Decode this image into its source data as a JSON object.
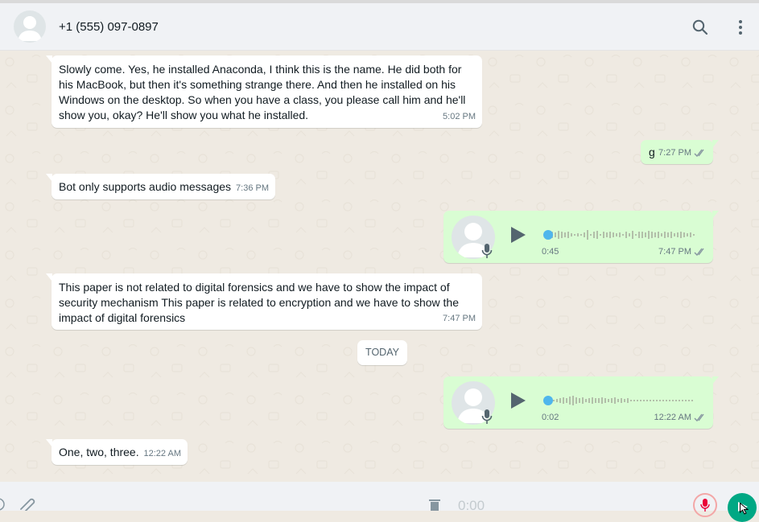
{
  "header": {
    "contact_name": "+1 (555) 097-0897",
    "icons": [
      "default-avatar-icon",
      "search-icon",
      "menu-kebab-icon"
    ]
  },
  "messages": [
    {
      "direction": "incoming",
      "text_lines": [
        "Slowly come. Yes, he installed Anaconda, I think this is the name. He did both for",
        "his MacBook, but then it's something strange there. And then he installed on his",
        "Windows on the desktop. So when you have a class, you please call him and he'll",
        "show you, okay? He'll show you what he installed."
      ],
      "time": "5:02 PM"
    },
    {
      "direction": "outgoing",
      "text": "g",
      "time": "7:27 PM",
      "status": "read-ticks-icon"
    },
    {
      "direction": "incoming",
      "text": "Bot only supports audio messages",
      "time": "7:36 PM"
    },
    {
      "direction": "outgoing",
      "type": "voice",
      "duration": "0:45",
      "time": "7:47 PM",
      "status": "read-ticks-icon",
      "progress": 0
    },
    {
      "direction": "incoming",
      "text_lines": [
        "This paper is not related to digital forensics and we have to show the impact of",
        "security mechanism This paper is related to encryption and we have to show the",
        "impact of digital forensics"
      ],
      "time": "7:47 PM"
    },
    {
      "direction": "outgoing",
      "type": "voice",
      "duration": "0:02",
      "time": "12:22 AM",
      "status": "read-ticks-icon",
      "progress": 0
    },
    {
      "direction": "incoming",
      "text": "One, two, three.",
      "time": "12:22 AM"
    }
  ],
  "date_separator": "TODAY",
  "footer": {
    "recording_time": "0:00",
    "icons": [
      "close-icon",
      "attach-icon",
      "delete-icon",
      "mic-icon",
      "send-icon"
    ]
  },
  "colors": {
    "chat_bg": "#efeae2",
    "incoming_bubble": "#ffffff",
    "outgoing_bubble": "#d9fdd3",
    "accent_blue": "#4fb6ec",
    "send_green": "#00a884",
    "mic_red": "#ea0038"
  }
}
